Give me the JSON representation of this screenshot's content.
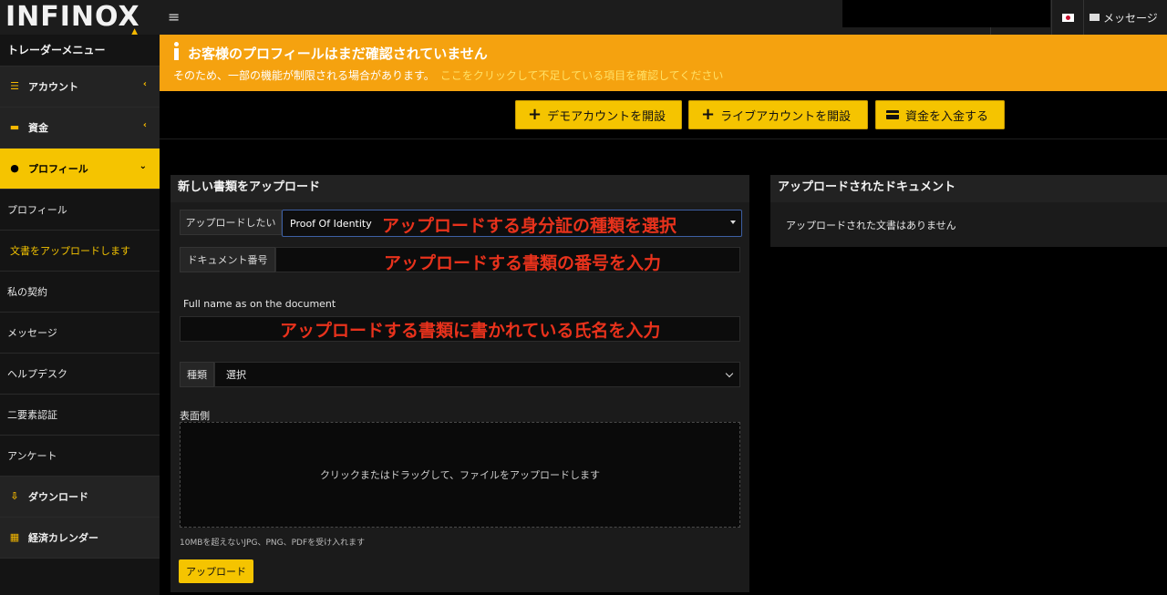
{
  "header": {
    "logo": "INFINOX",
    "messages_label": "メッセージ",
    "language": "ja"
  },
  "sidebar": {
    "title": "トレーダーメニュー",
    "items": [
      {
        "label": "アカウント",
        "icon": "list-icon"
      },
      {
        "label": "資金",
        "icon": "wallet-icon"
      },
      {
        "label": "プロフィール",
        "icon": "user-icon"
      }
    ],
    "subitems": [
      "プロフィール",
      "文書をアップロードします",
      "私の契約",
      "メッセージ",
      "ヘルプデスク",
      "二要素認証",
      "アンケート"
    ],
    "bottom_items": [
      {
        "label": "ダウンロード",
        "icon": "download-icon"
      },
      {
        "label": "経済カレンダー",
        "icon": "calendar-icon"
      }
    ]
  },
  "notice": {
    "title": "お客様のプロフィールはまだ確認されていません",
    "body": "そのため、一部の機能が制限される場合があります。",
    "link": "ここをクリックして不足している項目を確認してください"
  },
  "actions": {
    "demo": "デモアカウントを開設",
    "live": "ライブアカウントを開設",
    "deposit": "資金を入金する"
  },
  "upload_panel": {
    "title": "新しい書類をアップロード",
    "upload_type_label": "アップロードしたい",
    "upload_type_value": "Proof Of Identity",
    "doc_number_label": "ドキュメント番号",
    "full_name_label": "Full name as on the document",
    "kind_label": "種類",
    "kind_value": "選択",
    "front_label": "表面側",
    "dropzone_text": "クリックまたはドラッグして、ファイルをアップロードします",
    "hint": "10MBを超えないJPG、PNG、PDFを受け入れます",
    "upload_button": "アップロード"
  },
  "annotations": {
    "select_type": "アップロードする身分証の種類を選択",
    "doc_number": "アップロードする書類の番号を入力",
    "full_name": "アップロードする書類に書かれている氏名を入力"
  },
  "uploaded_panel": {
    "title": "アップロードされたドキュメント",
    "empty": "アップロードされた文書はありません"
  }
}
